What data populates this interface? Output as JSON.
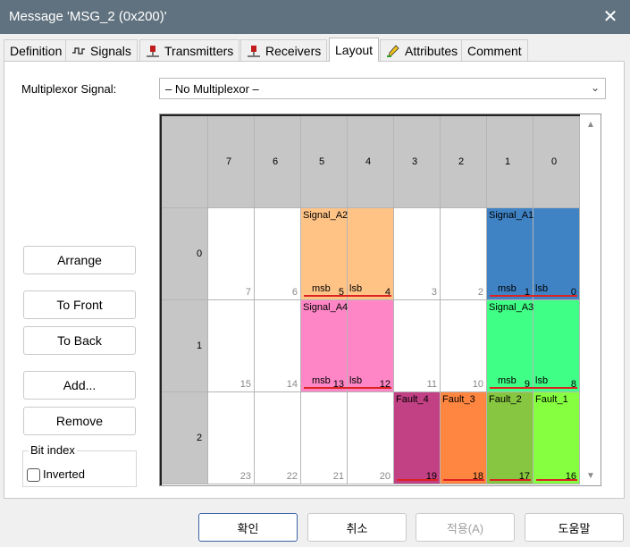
{
  "window": {
    "title": "Message 'MSG_2 (0x200)'",
    "close_glyph": "✕"
  },
  "tabs": [
    {
      "label": "Definition",
      "icon": ""
    },
    {
      "label": "Signals",
      "icon": "signal-wave-icon"
    },
    {
      "label": "Transmitters",
      "icon": "transmitter-icon"
    },
    {
      "label": "Receivers",
      "icon": "receiver-icon"
    },
    {
      "label": "Layout",
      "icon": ""
    },
    {
      "label": "Attributes",
      "icon": "pencil-icon"
    },
    {
      "label": "Comment",
      "icon": ""
    }
  ],
  "active_tab": "Layout",
  "multiplexor": {
    "label": "Multiplexor Signal:",
    "value": "– No Multiplexor –"
  },
  "side_buttons": {
    "arrange": "Arrange",
    "to_front": "To Front",
    "to_back": "To Back",
    "add": "Add...",
    "remove": "Remove"
  },
  "bit_index": {
    "title": "Bit index",
    "inverted_label": "Inverted",
    "inverted_checked": false
  },
  "layout": {
    "bit_headers": [
      "7",
      "6",
      "5",
      "4",
      "3",
      "2",
      "1",
      "0"
    ],
    "byte_headers": [
      "0",
      "1",
      "2"
    ],
    "bit_numbers": [
      [
        "7",
        "6",
        "5",
        "4",
        "3",
        "2",
        "1",
        "0"
      ],
      [
        "15",
        "14",
        "13",
        "12",
        "11",
        "10",
        "9",
        "8"
      ],
      [
        "23",
        "22",
        "21",
        "20",
        "19",
        "18",
        "17",
        "16"
      ]
    ],
    "msb_label": "msb",
    "lsb_label": "lsb",
    "signals": [
      {
        "name": "Signal_A2",
        "color": "#ffc386"
      },
      {
        "name": "Signal_A1",
        "color": "#4083c5"
      },
      {
        "name": "Signal_A4",
        "color": "#ff86c6"
      },
      {
        "name": "Signal_A3",
        "color": "#40ff86"
      },
      {
        "name": "Fault_4",
        "color": "#c24084"
      },
      {
        "name": "Fault_3",
        "color": "#ff8640"
      },
      {
        "name": "Fault_2",
        "color": "#86c640"
      },
      {
        "name": "Fault_1",
        "color": "#86ff40"
      }
    ]
  },
  "footer_buttons": {
    "ok": "확인",
    "cancel": "취소",
    "apply": "적용(A)",
    "help": "도움말"
  }
}
